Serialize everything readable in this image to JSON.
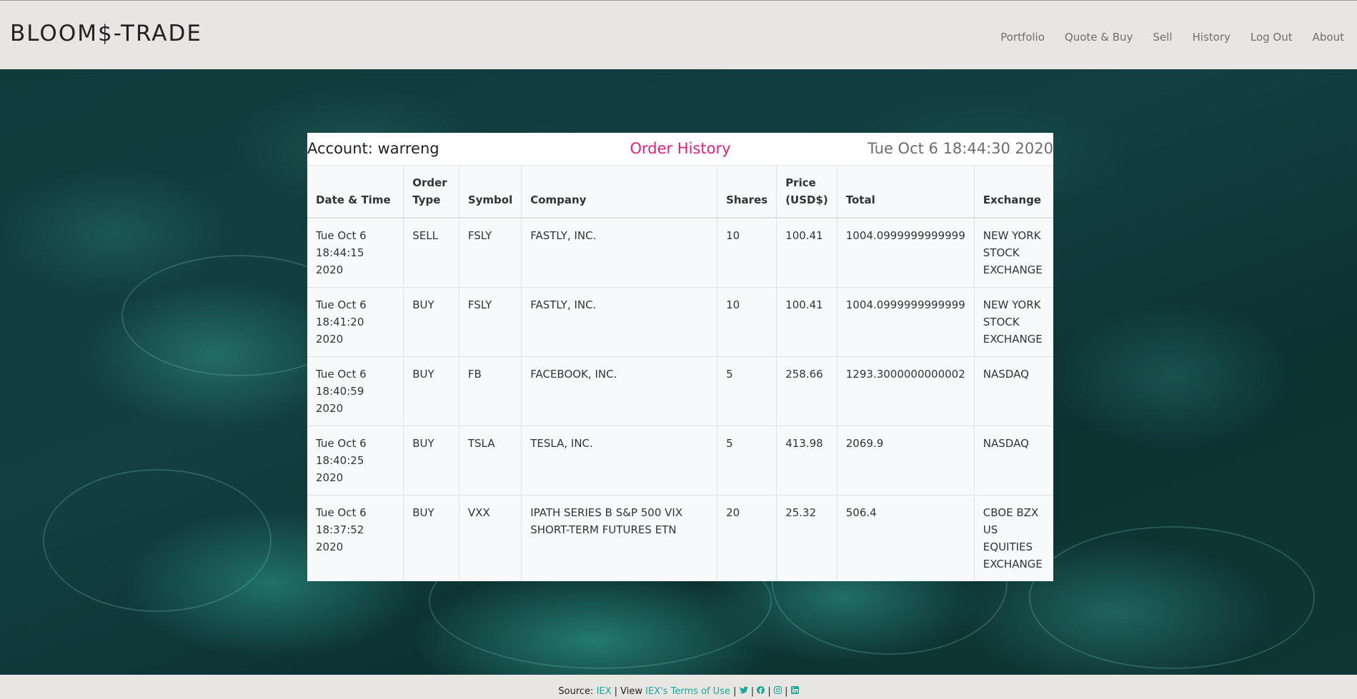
{
  "brand": "BLOOM$-TRADE",
  "nav": [
    "Portfolio",
    "Quote & Buy",
    "Sell",
    "History",
    "Log Out",
    "About"
  ],
  "header": {
    "account": "Account: warreng",
    "title": "Order History",
    "datetime": "Tue Oct 6 18:44:30 2020"
  },
  "table": {
    "columns": [
      "Date & Time",
      "Order Type",
      "Symbol",
      "Company",
      "Shares",
      "Price (USD$)",
      "Total",
      "Exchange"
    ],
    "rows": [
      [
        "Tue Oct 6 18:44:15 2020",
        "SELL",
        "FSLY",
        "FASTLY, INC.",
        "10",
        "100.41",
        "1004.0999999999999",
        "NEW YORK STOCK EXCHANGE"
      ],
      [
        "Tue Oct 6 18:41:20 2020",
        "BUY",
        "FSLY",
        "FASTLY, INC.",
        "10",
        "100.41",
        "1004.0999999999999",
        "NEW YORK STOCK EXCHANGE"
      ],
      [
        "Tue Oct 6 18:40:59 2020",
        "BUY",
        "FB",
        "FACEBOOK, INC.",
        "5",
        "258.66",
        "1293.3000000000002",
        "NASDAQ"
      ],
      [
        "Tue Oct 6 18:40:25 2020",
        "BUY",
        "TSLA",
        "TESLA, INC.",
        "5",
        "413.98",
        "2069.9",
        "NASDAQ"
      ],
      [
        "Tue Oct 6 18:37:52 2020",
        "BUY",
        "VXX",
        "IPATH SERIES B S&P 500 VIX SHORT-TERM FUTURES ETN",
        "20",
        "25.32",
        "506.4",
        "CBOE BZX US EQUITIES EXCHANGE"
      ]
    ]
  },
  "footer": {
    "source_label": "Source: ",
    "source_link": "IEX",
    "view_label": " | View ",
    "terms_link": "IEX's Terms of Use",
    "icons": [
      "twitter-icon",
      "facebook-icon",
      "instagram-icon",
      "linkedin-icon"
    ]
  },
  "colors": {
    "accent": "#e91e7a",
    "link": "#1ba89a"
  }
}
